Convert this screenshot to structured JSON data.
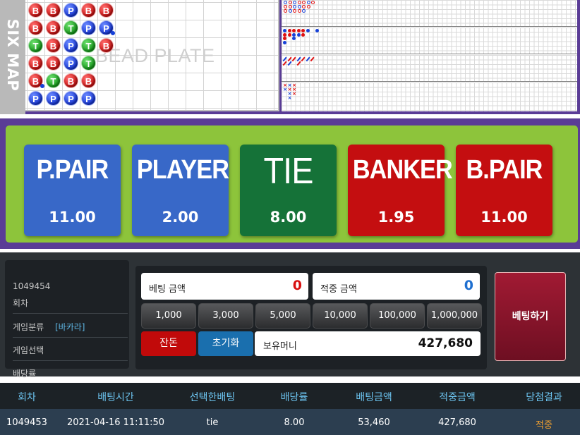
{
  "roadmap": {
    "sixmap_label": "SIX MAP",
    "bead_watermark": "BEAD PLATE",
    "bead_columns": [
      [
        {
          "t": "B"
        },
        {
          "t": "B"
        },
        {
          "t": "T"
        },
        {
          "t": "B"
        },
        {
          "t": "B",
          "mark": "blue"
        },
        {
          "t": "P"
        }
      ],
      [
        {
          "t": "B"
        },
        {
          "t": "B"
        },
        {
          "t": "B"
        },
        {
          "t": "B"
        },
        {
          "t": "T"
        },
        {
          "t": "P"
        }
      ],
      [
        {
          "t": "P"
        },
        {
          "t": "T"
        },
        {
          "t": "P"
        },
        {
          "t": "P"
        },
        {
          "t": "B"
        },
        {
          "t": "P"
        }
      ],
      [
        {
          "t": "B"
        },
        {
          "t": "P"
        },
        {
          "t": "T"
        },
        {
          "t": "T"
        },
        {
          "t": "B"
        },
        {
          "t": "P"
        }
      ],
      [
        {
          "t": "B"
        },
        {
          "t": "P",
          "mark": "blue"
        },
        {
          "t": "B"
        },
        null,
        null,
        null
      ]
    ],
    "colors": {
      "banker": "#e01010",
      "player": "#1540d8",
      "tie": "#159a1a"
    }
  },
  "bets": [
    {
      "id": "ppair",
      "label": "P.PAIR",
      "odds": "11.00",
      "color": "#3868c8"
    },
    {
      "id": "player",
      "label": "PLAYER",
      "odds": "2.00",
      "color": "#3868c8"
    },
    {
      "id": "tie",
      "label": "TIE",
      "odds": "8.00",
      "color": "#157238"
    },
    {
      "id": "banker",
      "label": "BANKER",
      "odds": "1.95",
      "color": "#c40e10"
    },
    {
      "id": "bpair",
      "label": "B.PAIR",
      "odds": "11.00",
      "color": "#c40e10"
    }
  ],
  "info": {
    "round_number": "1049454",
    "round_label": "회차",
    "category_label": "게임분류",
    "category_value": "[바카라]",
    "selection_label": "게임선택",
    "odds_label": "배당률"
  },
  "betting": {
    "bet_amount_label": "베팅 금액",
    "bet_amount_value": "0",
    "win_amount_label": "적중 금액",
    "win_amount_value": "0",
    "chips": [
      "1,000",
      "3,000",
      "5,000",
      "10,000",
      "100,000",
      "1,000,000"
    ],
    "change_label": "잔돈",
    "reset_label": "초기화",
    "balance_label": "보유머니",
    "balance_value": "427,680",
    "place_bet_label": "베팅하기"
  },
  "history": {
    "columns": [
      "회차",
      "배팅시간",
      "선택한배팅",
      "배당률",
      "배팅금액",
      "적중금액",
      "당첨결과"
    ],
    "rows": [
      [
        "1049453",
        "2021-04-16 11:11:50",
        "tie",
        "8.00",
        "53,460",
        "427,680",
        "적중"
      ]
    ],
    "result_color": "#f0a030"
  }
}
